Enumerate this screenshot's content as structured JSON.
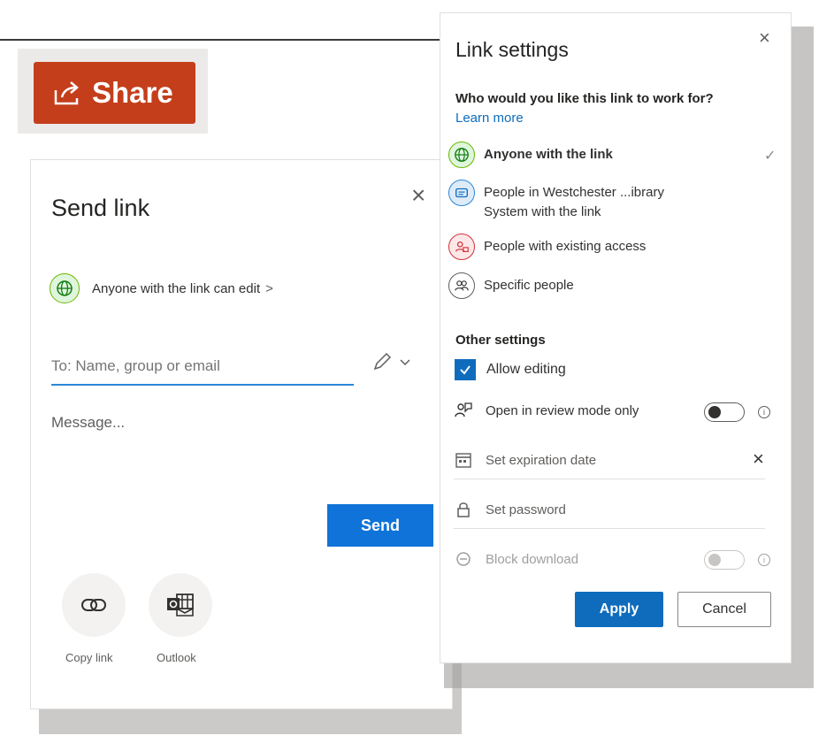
{
  "share": {
    "label": "Share"
  },
  "send_link": {
    "title": "Send link",
    "anyone_label": "Anyone with the link can edit",
    "anyone_chevron": ">",
    "to_placeholder": "To: Name, group or email",
    "message_placeholder": "Message...",
    "send_label": "Send",
    "copy_link_label": "Copy link",
    "outlook_label": "Outlook",
    "close": "×"
  },
  "link_settings": {
    "title": "Link settings",
    "close": "×",
    "question": "Who would you like this link to work for?",
    "learn_more": "Learn more",
    "options": [
      {
        "label": "Anyone with the link",
        "selected": true
      },
      {
        "label": "People in Westchester ...ibrary System with the link",
        "selected": false
      },
      {
        "label": "People with existing access",
        "selected": false
      },
      {
        "label": "Specific people",
        "selected": false
      }
    ],
    "selected_check": "✓",
    "other_settings_title": "Other settings",
    "allow_editing": {
      "label": "Allow editing",
      "checked": true
    },
    "review_mode": {
      "label": "Open in review mode only",
      "on": false
    },
    "expiration": {
      "label": "Set expiration date",
      "clear": "×"
    },
    "password": {
      "label": "Set password"
    },
    "block_download": {
      "label": "Block download",
      "on": false,
      "disabled": true
    },
    "apply_label": "Apply",
    "cancel_label": "Cancel"
  },
  "colors": {
    "share_bg": "#c43e1c",
    "primary": "#0f6cbd",
    "anyone_green": "#6bb700",
    "existing_red": "#d13438"
  }
}
